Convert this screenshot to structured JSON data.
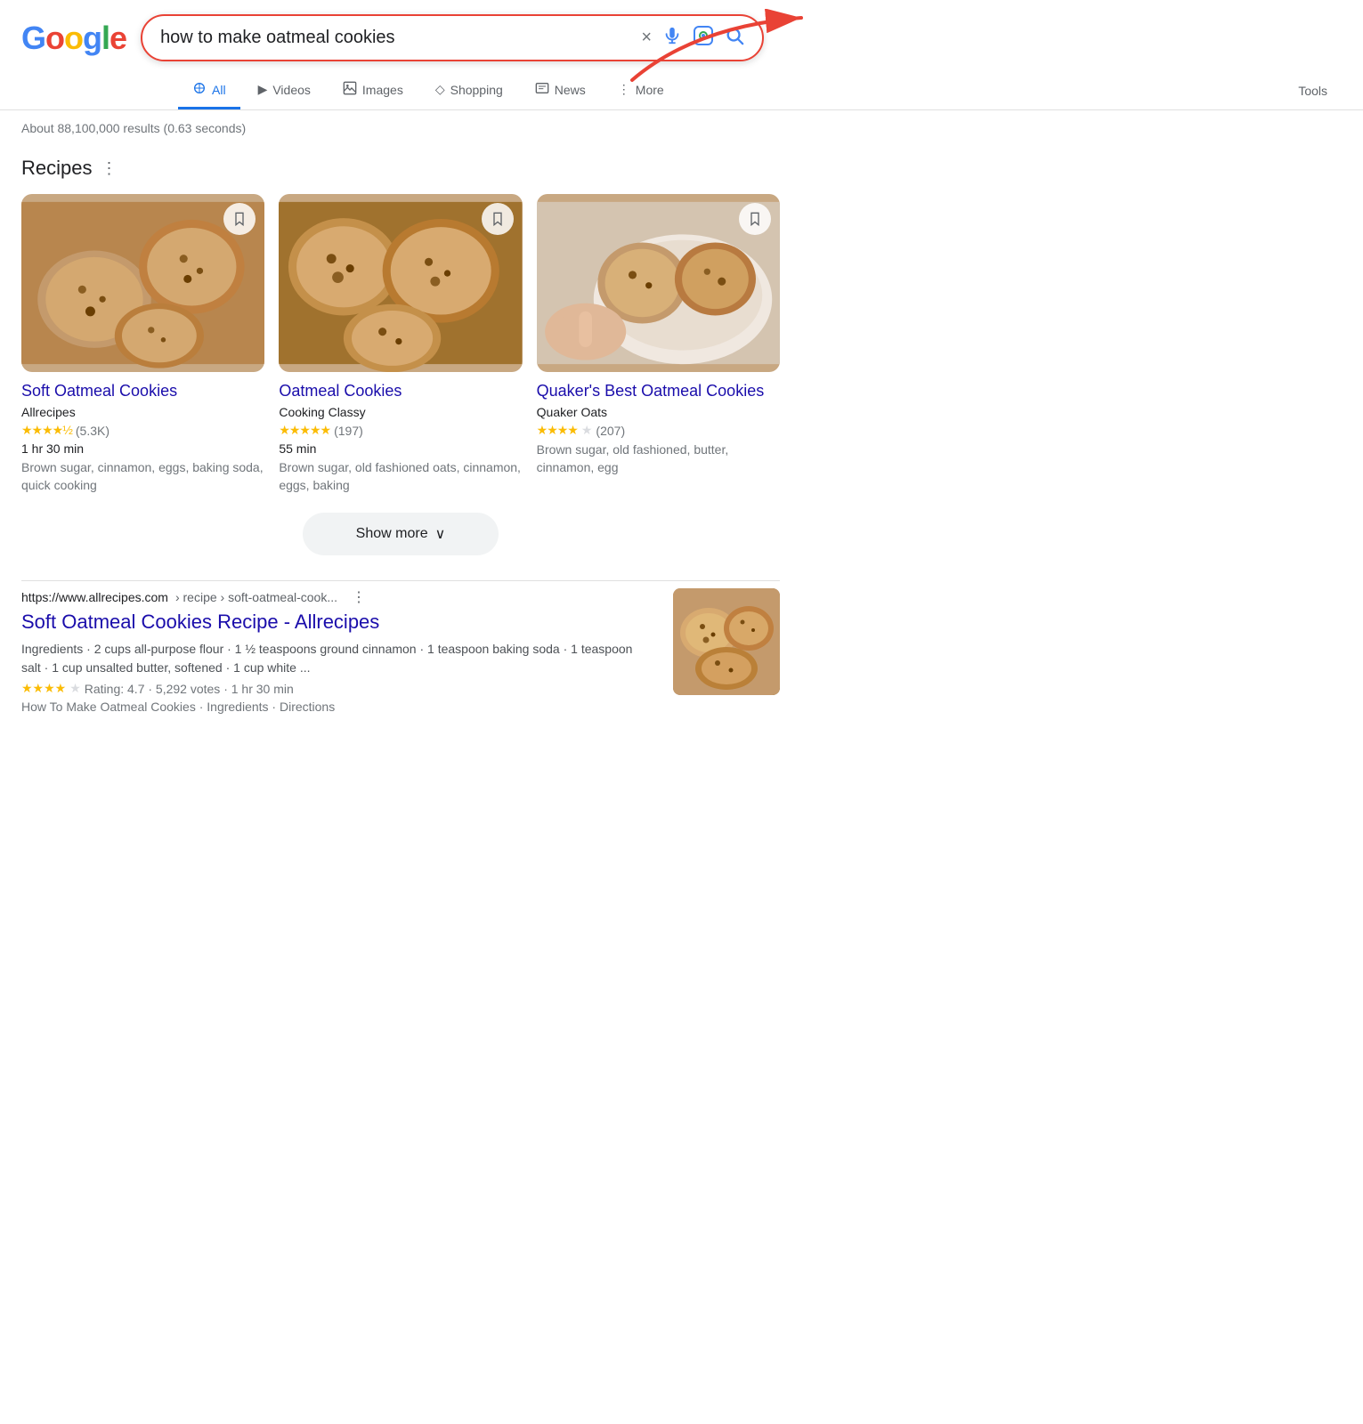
{
  "header": {
    "logo": {
      "g": "G",
      "o1": "o",
      "o2": "o",
      "g2": "g",
      "l": "l",
      "e": "e"
    },
    "search_query": "how to make oatmeal cookies",
    "clear_label": "×",
    "voice_label": "🎤",
    "lens_label": "⊡",
    "search_label": "🔍"
  },
  "nav": {
    "tabs": [
      {
        "label": "All",
        "icon": "🔍",
        "active": true
      },
      {
        "label": "Videos",
        "icon": "▶"
      },
      {
        "label": "Images",
        "icon": "⬜"
      },
      {
        "label": "Shopping",
        "icon": "◇"
      },
      {
        "label": "News",
        "icon": "⬛"
      },
      {
        "label": "More",
        "icon": "⋮"
      }
    ],
    "tools_label": "Tools"
  },
  "result_stats": "About 88,100,000 results (0.63 seconds)",
  "recipes_section": {
    "title": "Recipes",
    "more_icon": "⋮",
    "show_more_label": "Show more",
    "show_more_chevron": "∨",
    "cards": [
      {
        "title": "Soft Oatmeal Cookies",
        "source": "Allrecipes",
        "rating": "4.7",
        "stars_full": 4,
        "stars_half": true,
        "review_count": "(5.3K)",
        "time": "1 hr 30 min",
        "ingredients": "Brown sugar, cinnamon, eggs, baking soda, quick cooking"
      },
      {
        "title": "Oatmeal Cookies",
        "source": "Cooking Classy",
        "rating": "5.0",
        "stars_full": 5,
        "stars_half": false,
        "review_count": "(197)",
        "time": "55 min",
        "ingredients": "Brown sugar, old fashioned oats, cinnamon, eggs, baking"
      },
      {
        "title": "Quaker's Best Oatmeal Cookies",
        "source": "Quaker Oats",
        "rating": "4.0",
        "stars_full": 4,
        "stars_half": false,
        "review_count": "(207)",
        "time": "",
        "ingredients": "Brown sugar, old fashioned, butter, cinnamon, egg"
      }
    ]
  },
  "web_result": {
    "domain": "https://www.allrecipes.com",
    "path": "› recipe › soft-oatmeal-cook...",
    "title": "Soft Oatmeal Cookies Recipe - Allrecipes",
    "description": "Ingredients · 2 cups all-purpose flour · 1 ½ teaspoons ground cinnamon · 1 teaspoon baking soda · 1 teaspoon salt · 1 cup unsalted butter, softened · 1 cup white ...",
    "rating_text": "Rating: 4.7 · 5,292 votes · 1 hr 30 min",
    "links": "How To Make Oatmeal Cookies · Ingredients · Directions"
  }
}
